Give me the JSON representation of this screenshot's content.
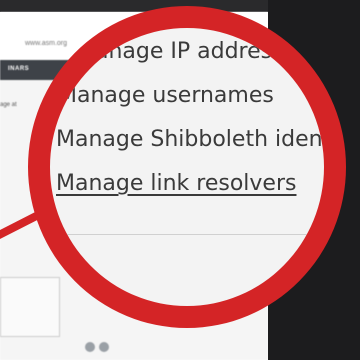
{
  "background_page": {
    "url_text": "www.asm.org",
    "nav_label": "INARS",
    "side_text": "age at"
  },
  "lens": {
    "items": [
      {
        "label": "Manage IP addresses",
        "is_link": false
      },
      {
        "label": "Manage usernames",
        "is_link": false
      },
      {
        "label": "Manage Shibboleth identities",
        "is_link": false
      },
      {
        "label": "Manage link resolvers",
        "is_link": true
      }
    ]
  },
  "colors": {
    "lens_rim": "#d42426",
    "bezel": "#1c1c1e"
  }
}
